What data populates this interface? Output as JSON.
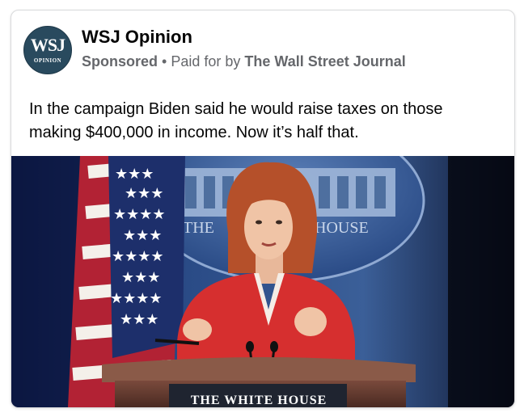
{
  "advertiser": {
    "logo_text_main": "WSJ",
    "logo_text_sub": "OPINION",
    "name": "WSJ Opinion"
  },
  "meta": {
    "sponsored": "Sponsored",
    "separator": "•",
    "paid_for_by": "Paid for by",
    "payer": "The Wall Street Journal"
  },
  "post": {
    "line1": "In the campaign Biden said he would raise taxes on those",
    "line2": "making $400,000 in income. Now it’s half that."
  },
  "photo": {
    "seal_text_left": "THE",
    "seal_text_right": "HOUSE",
    "podium_text": "THE WHITE HOUSE"
  },
  "colors": {
    "logo_bg": "#294a5e",
    "backdrop_blue": "#2c4f86",
    "jacket_red": "#d62f2f"
  }
}
